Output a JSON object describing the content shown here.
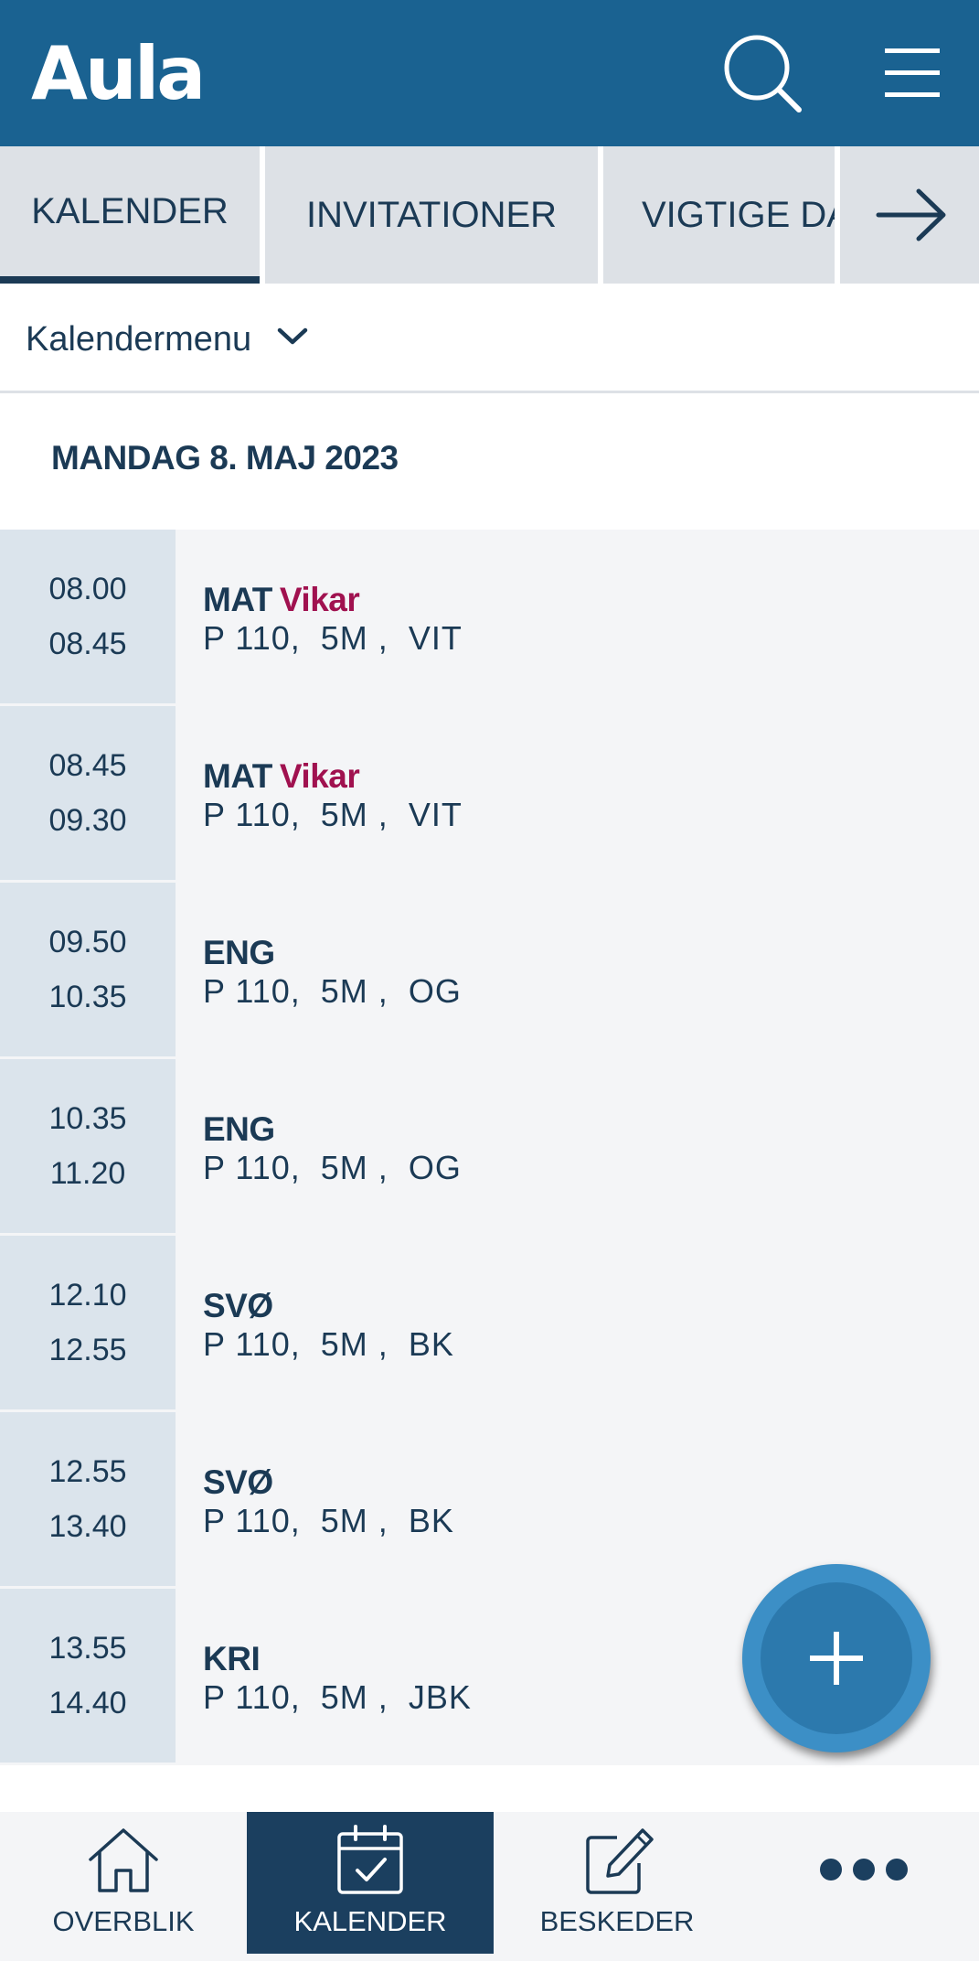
{
  "header": {
    "logo_text": "Aula",
    "color": "#1a6291",
    "icons": [
      "search-icon",
      "hamburger-menu-icon"
    ]
  },
  "tabs": [
    {
      "label": "KALENDER",
      "active": true
    },
    {
      "label": "INVITATIONER",
      "active": false
    },
    {
      "label": "VIGTIGE DA",
      "active": false
    }
  ],
  "tabs_more_icon": "arrow-right-icon",
  "calendar_menu": {
    "label": "Kalendermenu",
    "icon": "chevron-down-icon"
  },
  "date_heading": "MANDAG 8. MAJ 2023",
  "events": [
    {
      "start": "08.00",
      "end": "08.45",
      "subject": "MAT",
      "tag": "Vikar",
      "room": "P 110,",
      "class": "5M ,",
      "teacher": "VIT"
    },
    {
      "start": "08.45",
      "end": "09.30",
      "subject": "MAT",
      "tag": "Vikar",
      "room": "P 110,",
      "class": "5M ,",
      "teacher": "VIT"
    },
    {
      "start": "09.50",
      "end": "10.35",
      "subject": "ENG",
      "tag": "",
      "room": "P 110,",
      "class": "5M ,",
      "teacher": "OG"
    },
    {
      "start": "10.35",
      "end": "11.20",
      "subject": "ENG",
      "tag": "",
      "room": "P 110,",
      "class": "5M ,",
      "teacher": "OG"
    },
    {
      "start": "12.10",
      "end": "12.55",
      "subject": "SVØ",
      "tag": "",
      "room": "P 110,",
      "class": "5M ,",
      "teacher": "BK"
    },
    {
      "start": "12.55",
      "end": "13.40",
      "subject": "SVØ",
      "tag": "",
      "room": "P 110,",
      "class": "5M ,",
      "teacher": "BK"
    },
    {
      "start": "13.55",
      "end": "14.40",
      "subject": "KRI",
      "tag": "",
      "room": "P 110,",
      "class": "5M ,",
      "teacher": "JBK"
    }
  ],
  "tag_color": "#a0114f",
  "fab": {
    "icon": "plus-icon",
    "color": "#3c8fc6"
  },
  "bottom_nav": [
    {
      "label": "OVERBLIK",
      "icon": "home-icon",
      "active": false
    },
    {
      "label": "KALENDER",
      "icon": "calendar-check-icon",
      "active": true
    },
    {
      "label": "BESKEDER",
      "icon": "compose-icon",
      "active": false
    },
    {
      "label": "",
      "icon": "more-dots-icon",
      "active": false
    }
  ]
}
